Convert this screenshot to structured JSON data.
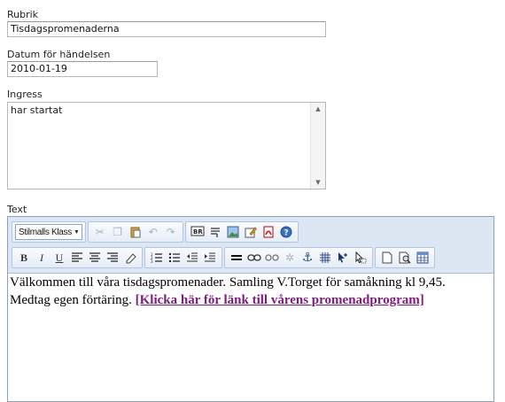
{
  "fields": {
    "rubrik": {
      "label": "Rubrik",
      "value": "Tisdagspromenaderna"
    },
    "datum": {
      "label": "Datum för händelsen",
      "value": "2010-01-19"
    },
    "ingress": {
      "label": "Ingress",
      "value": "har startat"
    },
    "text": {
      "label": "Text"
    }
  },
  "editor": {
    "style_select": "Stilmalls Klass",
    "content_line1": "Välkommen till våra tisdagspromenader. Samling V.Torget för samåkning kl 9,45.",
    "content_line2": "Medtag egen förtäring. ",
    "link_text": "[Klicka här för länk till vårens promenadprogram]",
    "toolbar_row1": [
      "cut-icon",
      "copy-icon",
      "paste-icon",
      "undo-icon",
      "redo-icon",
      "insert-break-icon",
      "paragraph-icon",
      "insert-image-icon",
      "edit-icon",
      "pdf-icon",
      "help-icon"
    ],
    "toolbar_row2": [
      "bold-icon",
      "italic-icon",
      "underline-icon",
      "align-left-icon",
      "align-center-icon",
      "align-right-icon",
      "eraser-icon",
      "ordered-list-icon",
      "unordered-list-icon",
      "outdent-icon",
      "indent-icon",
      "horizontal-rule-icon",
      "link-icon",
      "unlink-icon",
      "anchor-unlink-icon",
      "anchor-icon",
      "table-icon",
      "pointer-add-icon",
      "pointer-select-icon",
      "new-page-icon",
      "preview-icon",
      "table-props-icon"
    ]
  },
  "colors": {
    "toolbar_bg": "#dde7f4",
    "link": "#7d1b7e",
    "editor_border": "#8ba0bc"
  }
}
